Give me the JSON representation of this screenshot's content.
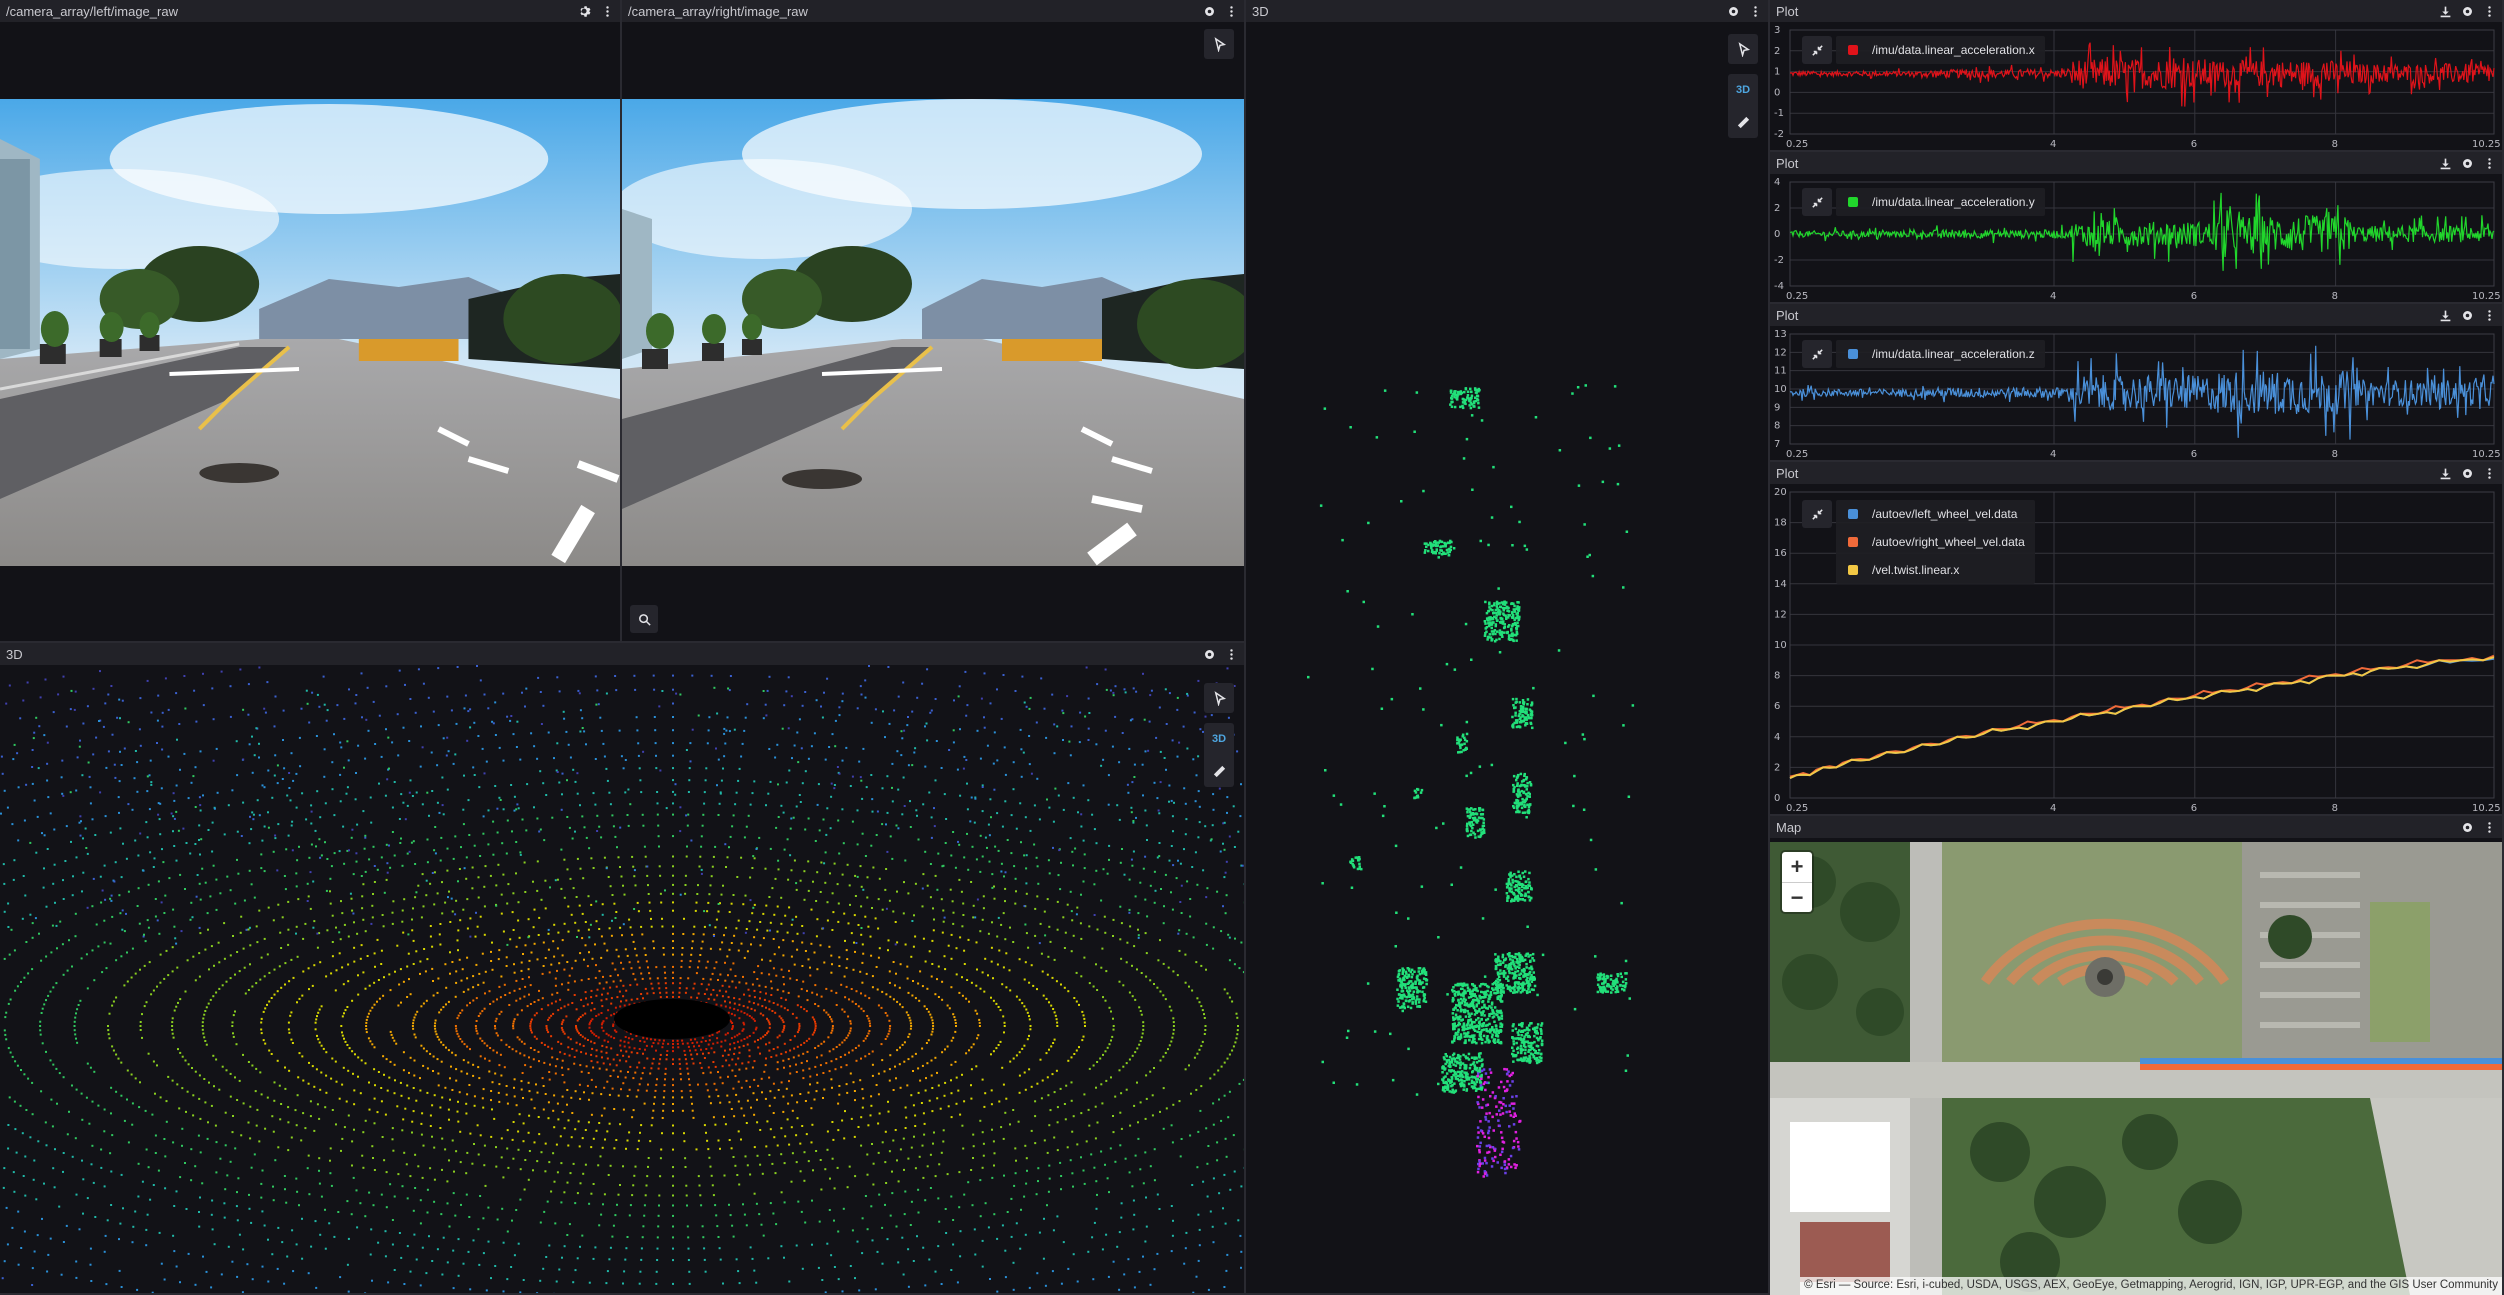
{
  "panels": {
    "cam_left": {
      "title": "/camera_array/left/image_raw"
    },
    "cam_right": {
      "title": "/camera_array/right/image_raw"
    },
    "lidar_3d": {
      "title": "3D",
      "mode_label": "3D"
    },
    "top_3d": {
      "title": "3D",
      "mode_label": "3D"
    },
    "plot1": {
      "title": "Plot",
      "legend": [
        {
          "label": "/imu/data.linear_acceleration.x",
          "color": "#e0131a"
        }
      ]
    },
    "plot2": {
      "title": "Plot",
      "legend": [
        {
          "label": "/imu/data.linear_acceleration.y",
          "color": "#21d62c"
        }
      ]
    },
    "plot3": {
      "title": "Plot",
      "legend": [
        {
          "label": "/imu/data.linear_acceleration.z",
          "color": "#4a90d9"
        }
      ]
    },
    "plot4": {
      "title": "Plot",
      "legend": [
        {
          "label": "/autoev/left_wheel_vel.data",
          "color": "#4a90d9"
        },
        {
          "label": "/autoev/right_wheel_vel.data",
          "color": "#f06a3a"
        },
        {
          "label": "/vel.twist.linear.x",
          "color": "#f2c744"
        }
      ]
    },
    "map": {
      "title": "Map",
      "zoom_in": "+",
      "zoom_out": "−",
      "attribution": "© Esri — Source: Esri, i-cubed, USDA, USGS, AEX, GeoEye, Getmapping, Aerogrid, IGN, IGP, UPR-EGP, and the GIS User Community"
    }
  },
  "chart_data": [
    {
      "type": "line",
      "title": "",
      "xlabel": "",
      "ylabel": "",
      "xlim": [
        0.25,
        10.25
      ],
      "ylim": [
        -2,
        3
      ],
      "x_ticks": [
        "0.25",
        "4",
        "6",
        "8",
        "10.25"
      ],
      "y_ticks": [
        "-2",
        "-1",
        "0",
        "1",
        "2",
        "3"
      ],
      "series": [
        {
          "name": "/imu/data.linear_acceleration.x",
          "color": "#e0131a",
          "baseline": 0.9,
          "noise": [
            0.15,
            0.25,
            0.9,
            0.8,
            0.6
          ]
        }
      ]
    },
    {
      "type": "line",
      "title": "",
      "xlabel": "",
      "ylabel": "",
      "xlim": [
        0.25,
        10.25
      ],
      "ylim": [
        -4,
        4
      ],
      "x_ticks": [
        "0.25",
        "4",
        "6",
        "8",
        "10.25"
      ],
      "y_ticks": [
        "-4",
        "-2",
        "0",
        "2",
        "4"
      ],
      "series": [
        {
          "name": "/imu/data.linear_acceleration.y",
          "color": "#21d62c",
          "baseline": 0.0,
          "noise": [
            0.3,
            0.4,
            1.2,
            1.8,
            0.8
          ]
        }
      ]
    },
    {
      "type": "line",
      "title": "",
      "xlabel": "",
      "ylabel": "",
      "xlim": [
        0.25,
        10.25
      ],
      "ylim": [
        7,
        13
      ],
      "x_ticks": [
        "0.25",
        "4",
        "6",
        "8",
        "10.25"
      ],
      "y_ticks": [
        "7",
        "8",
        "9",
        "10",
        "11",
        "12",
        "13"
      ],
      "series": [
        {
          "name": "/imu/data.linear_acceleration.z",
          "color": "#4a90d9",
          "baseline": 9.8,
          "noise": [
            0.25,
            0.35,
            1.2,
            1.5,
            0.9
          ]
        }
      ]
    },
    {
      "type": "line",
      "title": "",
      "xlabel": "",
      "ylabel": "",
      "xlim": [
        0.25,
        10.25
      ],
      "ylim": [
        0,
        20
      ],
      "x_ticks": [
        "0.25",
        "4",
        "6",
        "8",
        "10.25"
      ],
      "y_ticks": [
        "0",
        "2",
        "4",
        "6",
        "8",
        "10",
        "12",
        "14",
        "16",
        "18",
        "20"
      ],
      "series": [
        {
          "name": "/autoev/left_wheel_vel.data",
          "color": "#4a90d9",
          "x": [
            0.25,
            1,
            2,
            3,
            4,
            5,
            6,
            7,
            8,
            9,
            10.25
          ],
          "y": [
            1.3,
            2.2,
            3.2,
            4.2,
            5.0,
            5.8,
            6.6,
            7.3,
            8.0,
            8.6,
            9.1
          ]
        },
        {
          "name": "/autoev/right_wheel_vel.data",
          "color": "#f06a3a",
          "x": [
            0.25,
            1,
            2,
            3,
            4,
            5,
            6,
            7,
            8,
            9,
            10.25
          ],
          "y": [
            1.4,
            2.3,
            3.3,
            4.3,
            5.1,
            5.9,
            6.7,
            7.4,
            8.1,
            8.7,
            9.3
          ]
        },
        {
          "name": "/vel.twist.linear.x",
          "color": "#f2c744",
          "x": [
            0.25,
            1,
            2,
            3,
            4,
            5,
            6,
            7,
            8,
            9,
            10.25
          ],
          "y": [
            1.3,
            2.2,
            3.2,
            4.2,
            5.0,
            5.8,
            6.6,
            7.3,
            8.0,
            8.6,
            9.2
          ]
        }
      ]
    }
  ]
}
